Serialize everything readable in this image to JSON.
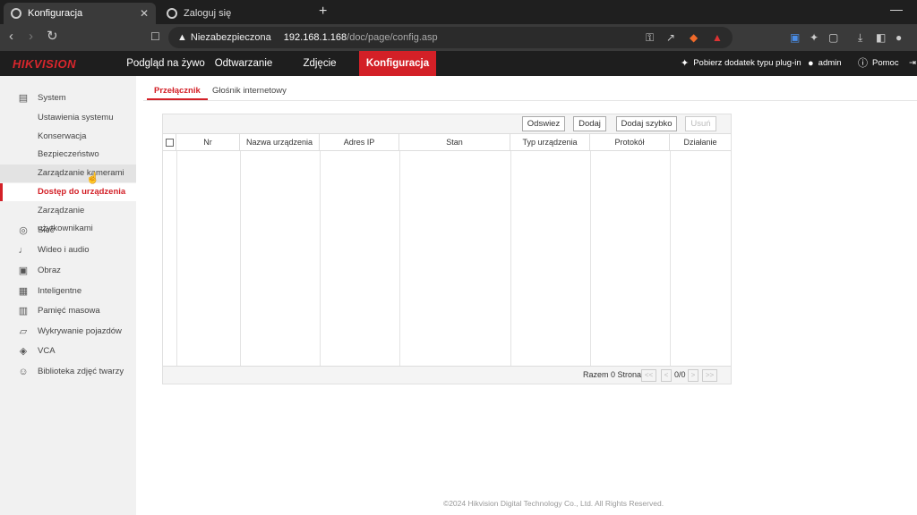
{
  "browser": {
    "tabs": [
      {
        "label": "Konfiguracja",
        "close": "✕"
      },
      {
        "label": "Zaloguj się"
      }
    ],
    "new_tab": "+",
    "minimize": "—",
    "address": {
      "security": "Niezabezpieczona",
      "host": "192.168.1.168",
      "path": "/doc/page/config.asp"
    }
  },
  "app": {
    "logo": "HIKVISION",
    "nav": [
      "Podgląd na żywo",
      "Odtwarzanie",
      "Zdjęcie",
      "Konfiguracja"
    ],
    "plugin": "Pobierz dodatek typu plug-in",
    "user": "admin",
    "help": "Pomoc"
  },
  "sidebar": {
    "items": [
      {
        "label": "System",
        "icon": "system-icon"
      },
      {
        "label": "Ustawienia systemu"
      },
      {
        "label": "Konserwacja"
      },
      {
        "label": "Bezpieczeństwo"
      },
      {
        "label": "Zarządzanie kamerami"
      },
      {
        "label": "Dostęp do urządzenia"
      },
      {
        "label": "Zarządzanie użytkownikami"
      },
      {
        "label": "Sieć",
        "icon": "network-globe-icon"
      },
      {
        "label": "Wideo i audio",
        "icon": "microphone-icon"
      },
      {
        "label": "Obraz",
        "icon": "image-icon"
      },
      {
        "label": "Inteligentne",
        "icon": "calendar-icon"
      },
      {
        "label": "Pamięć masowa",
        "icon": "storage-icon"
      },
      {
        "label": "Wykrywanie pojazdów",
        "icon": "vehicle-icon"
      },
      {
        "label": "VCA",
        "icon": "vca-icon"
      },
      {
        "label": "Biblioteka zdjęć twarzy",
        "icon": "face-icon"
      }
    ]
  },
  "subtabs": [
    "Przełącznik",
    "Głośnik internetowy"
  ],
  "table": {
    "buttons": [
      "Odswiez",
      "Dodaj",
      "Dodaj szybko",
      "Usuń"
    ],
    "columns": [
      "Nr",
      "Nazwa urządzenia",
      "Adres IP",
      "Stan",
      "Typ urządzenia",
      "Protokół",
      "Działanie"
    ],
    "rows": [],
    "footer": {
      "summary": "Razem 0 Strona",
      "page": "0/0",
      "first": "<<",
      "prev": "<",
      "next": ">",
      "last": ">>"
    }
  },
  "footer": "©2024 Hikvision Digital Technology Co., Ltd. All Rights Reserved.",
  "colors": {
    "accent": "#d32027",
    "header_bg": "#1e1e1e",
    "sidebar_bg": "#f1f1f1"
  }
}
